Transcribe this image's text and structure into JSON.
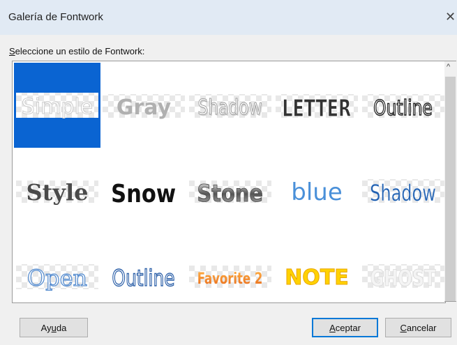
{
  "window": {
    "title": "Galería de Fontwork",
    "close_glyph": "✕"
  },
  "prompt": {
    "mnemonic": "S",
    "rest": "eleccione un estilo de Fontwork:"
  },
  "gallery": {
    "items": [
      {
        "label": "Simple",
        "selected": true
      },
      {
        "label": "Gray",
        "selected": false
      },
      {
        "label": "Shadow",
        "selected": false
      },
      {
        "label": "LETTER",
        "selected": false
      },
      {
        "label": "Outline",
        "selected": false
      },
      {
        "label": "Style",
        "selected": false
      },
      {
        "label": "Snow",
        "selected": false
      },
      {
        "label": "Stone",
        "selected": false
      },
      {
        "label": "blue",
        "selected": false
      },
      {
        "label": "Shadow",
        "selected": false
      },
      {
        "label": "Open",
        "selected": false
      },
      {
        "label": "Outline",
        "selected": false
      },
      {
        "label": "Favorite 2",
        "selected": false
      },
      {
        "label": "NOTE",
        "selected": false
      },
      {
        "label": "GHOST",
        "selected": false
      }
    ]
  },
  "scrollbar": {
    "up_arrow": "^"
  },
  "buttons": {
    "help": {
      "pre": "Ay",
      "mnemonic": "u",
      "post": "da"
    },
    "ok": {
      "mnemonic": "A",
      "post": "ceptar"
    },
    "cancel": {
      "mnemonic": "C",
      "post": "ancelar"
    }
  },
  "colors": {
    "selection": "#0a64d2",
    "titlebar": "#e1eaf4",
    "accent": "#0078d7"
  }
}
